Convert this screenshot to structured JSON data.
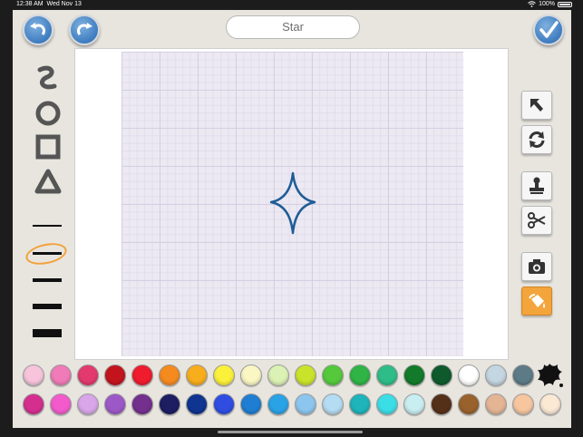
{
  "status": {
    "time": "12:38 AM",
    "date": "Wed Nov 13",
    "battery": "100%"
  },
  "header": {
    "title": "Star"
  },
  "colors": {
    "row1": [
      "#f7c4dc",
      "#f07bb8",
      "#e23a6e",
      "#c3141e",
      "#ee1c2c",
      "#f58a1f",
      "#f8ad1c",
      "#fbf03a",
      "#fbf7c3",
      "#dcf2b4",
      "#c8e42a",
      "#55c93b",
      "#2fb445",
      "#2ebd88",
      "#127a2a",
      "#0f5a2d",
      "#ffffff",
      "#c4d6e2",
      "#5d7b86"
    ],
    "row2": [
      "#d42f8e",
      "#f35bcc",
      "#d9a6ea",
      "#9d58c7",
      "#74308d",
      "#1d1d62",
      "#0f3591",
      "#2f4de0",
      "#1f7ed2",
      "#2aa3e6",
      "#8cc6ee",
      "#b4dcf3",
      "#1eb4b9",
      "#3bdee7",
      "#c8eef2",
      "#553019",
      "#99622c",
      "#e4b594",
      "#f7c69e",
      "#fbe9d4"
    ]
  }
}
